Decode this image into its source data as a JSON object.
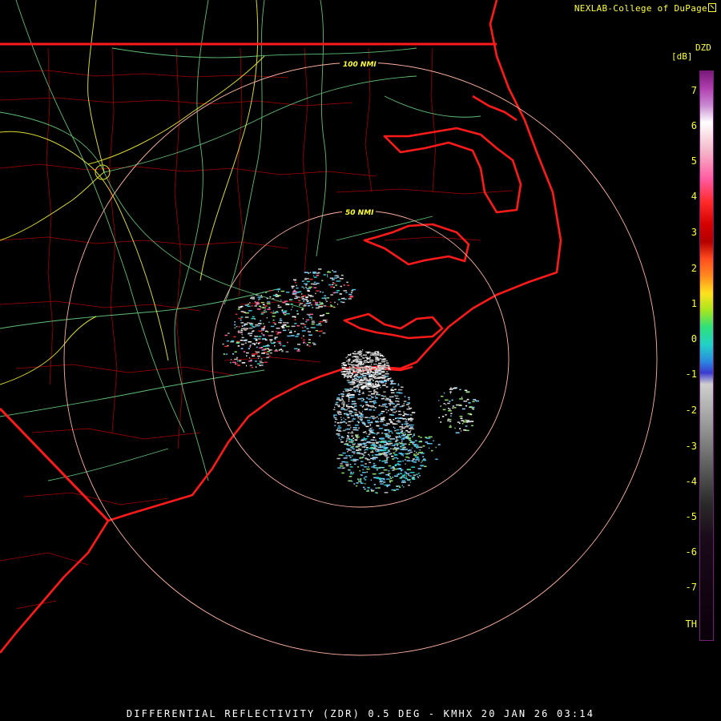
{
  "credit": "NEXLAB-College of DuPage",
  "legend": {
    "product": "DZD",
    "unit": "[dB]",
    "ticks": [
      "7",
      "6",
      "5",
      "4",
      "3",
      "2",
      "1",
      "0",
      "-1",
      "-2",
      "-3",
      "-4",
      "-5",
      "-6",
      "-7",
      "TH"
    ],
    "gradient": [
      "#7a1a7a 0%",
      "#b03fb0 3%",
      "#c98ad2 6%",
      "#ffffff 9%",
      "#f4b7c9 14%",
      "#ff5aa0 19%",
      "#ff2a2a 23%",
      "#d40000 27%",
      "#b40000 30%",
      "#ff4e1e 33%",
      "#ff8a1e 36%",
      "#ffe21e 39%",
      "#a6e61e 42%",
      "#2ee07a 45%",
      "#22d2c6 48%",
      "#2a8ae0 51%",
      "#3a3ad0 53%",
      "#cfcfcf 55%",
      "#9a9a9a 62%",
      "#5a5a5a 70%",
      "#2a2a2a 76%",
      "#1a0a1a 82%",
      "#0a000a 100%"
    ]
  },
  "range_rings": [
    "50 NMI",
    "100 NMI"
  ],
  "footer": "DIFFERENTIAL REFLECTIVITY (ZDR) 0.5 DEG - KMHX 20 JAN 26 03:14",
  "colors": {
    "state_border": "#ff1a1a",
    "county_border": "#c80000",
    "highways": "#6fe08a",
    "interstates": "#ffff33",
    "range_ring": "#ffb0a0"
  }
}
